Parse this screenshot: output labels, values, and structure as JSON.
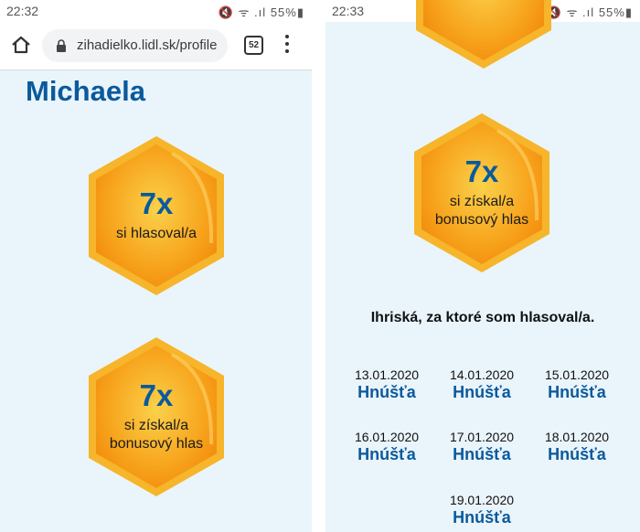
{
  "left": {
    "status": {
      "time": "22:32",
      "icons": "🔇 ᯤ .ıl",
      "battery": "55%"
    },
    "url": "zihadielko.lidl.sk/profile",
    "tab_count": "52",
    "username": "Michaela",
    "badges": [
      {
        "count": "7x",
        "line1": "si hlasoval/a",
        "line2": ""
      },
      {
        "count": "7x",
        "line1": "si získal/a",
        "line2": "bonusový hlas"
      }
    ]
  },
  "right": {
    "status": {
      "time": "22:33",
      "icons": "🔇 ᯤ .ıl",
      "battery": "55%"
    },
    "badge": {
      "count": "7x",
      "line1": "si získal/a",
      "line2": "bonusový hlas"
    },
    "section_title": "Ihriská, za ktoré som hlasoval/a.",
    "visits": [
      {
        "date": "13.01.2020",
        "place": "Hnúšťa"
      },
      {
        "date": "14.01.2020",
        "place": "Hnúšťa"
      },
      {
        "date": "15.01.2020",
        "place": "Hnúšťa"
      },
      {
        "date": "16.01.2020",
        "place": "Hnúšťa"
      },
      {
        "date": "17.01.2020",
        "place": "Hnúšťa"
      },
      {
        "date": "18.01.2020",
        "place": "Hnúšťa"
      },
      {
        "date": "19.01.2020",
        "place": "Hnúšťa"
      }
    ]
  },
  "colors": {
    "accent": "#0a5a9c",
    "hex_fill": "#f7a21b",
    "background": "#eaf4fb"
  }
}
